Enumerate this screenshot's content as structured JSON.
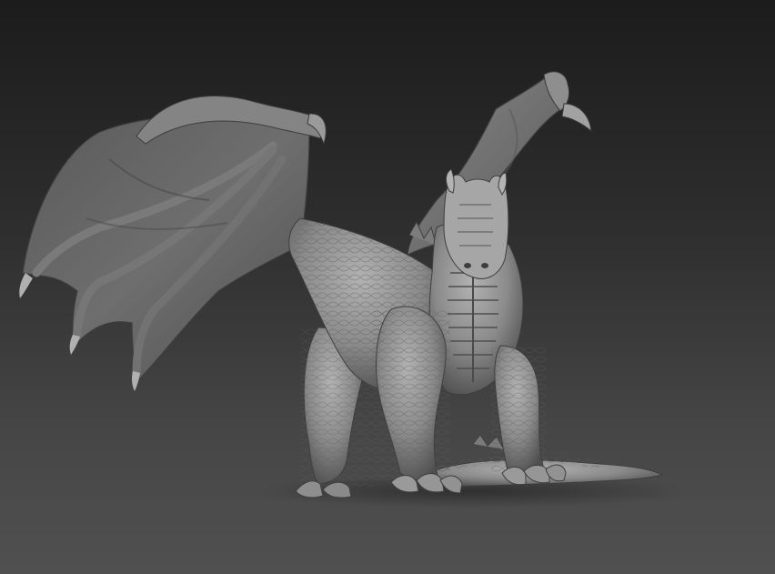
{
  "scene": {
    "subject_icon": "dragon-sculpt",
    "colors": {
      "background_top": "#1c1c1c",
      "background_bottom": "#505050",
      "clay_light": "#a9a9a9",
      "clay_mid": "#7e7e7e",
      "clay_dark": "#4a4a4a",
      "membrane": "#626262"
    }
  }
}
